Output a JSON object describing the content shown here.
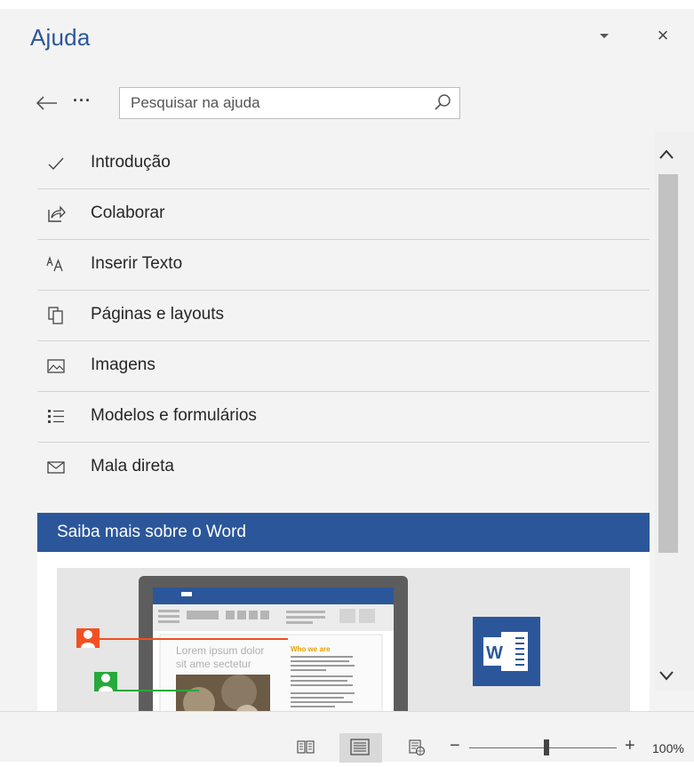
{
  "pane": {
    "title": "Ajuda",
    "close_glyph": "×"
  },
  "search": {
    "placeholder": "Pesquisar na ajuda",
    "more_glyph": "···"
  },
  "topics": [
    {
      "label": "Introdução",
      "icon": "checkmark-icon"
    },
    {
      "label": "Colaborar",
      "icon": "share-icon"
    },
    {
      "label": "Inserir Texto",
      "icon": "font-size-icon"
    },
    {
      "label": "Páginas e layouts",
      "icon": "pages-icon"
    },
    {
      "label": "Imagens",
      "icon": "picture-icon"
    },
    {
      "label": "Modelos e formulários",
      "icon": "list-icon"
    },
    {
      "label": "Mala direta",
      "icon": "envelope-icon"
    }
  ],
  "learn_more": {
    "banner_text": "Saiba mais sobre o Word",
    "illustration": {
      "doc_heading": "Lorem ipsum dolor sit ame sectetur",
      "doc_side_heading": "Who we are",
      "app_letter": "W"
    }
  },
  "statusbar": {
    "zoom_level": "100%",
    "zoom_minus": "−",
    "zoom_plus": "+"
  },
  "colors": {
    "accent": "#2b579a",
    "pane_bg": "#f3f3f3",
    "user_orange": "#f25022",
    "user_green": "#27a93c"
  }
}
